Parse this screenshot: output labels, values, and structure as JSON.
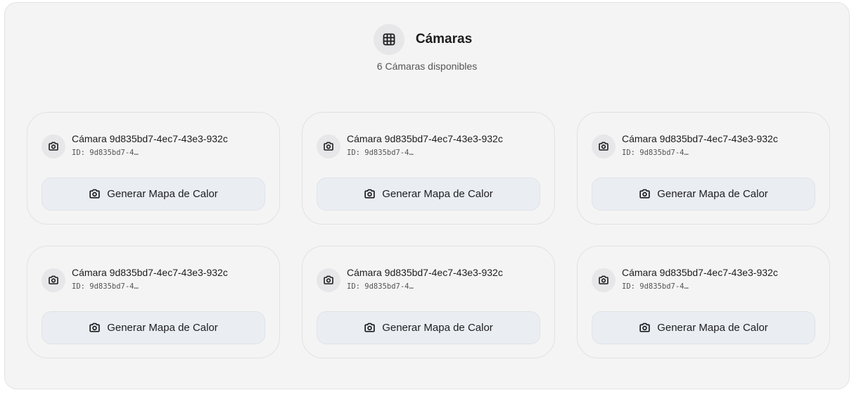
{
  "header": {
    "icon": "grid-icon",
    "title": "Cámaras",
    "subtitle": "6 Cámaras disponibles"
  },
  "cameras": [
    {
      "name": "Cámara 9d835bd7-4ec7-43e3-932c",
      "id": "ID: 9d835bd7-4…",
      "button_label": "Generar Mapa de Calor",
      "icon": "camera-icon"
    },
    {
      "name": "Cámara 9d835bd7-4ec7-43e3-932c",
      "id": "ID: 9d835bd7-4…",
      "button_label": "Generar Mapa de Calor",
      "icon": "camera-icon"
    },
    {
      "name": "Cámara 9d835bd7-4ec7-43e3-932c",
      "id": "ID: 9d835bd7-4…",
      "button_label": "Generar Mapa de Calor",
      "icon": "camera-icon"
    },
    {
      "name": "Cámara 9d835bd7-4ec7-43e3-932c",
      "id": "ID: 9d835bd7-4…",
      "button_label": "Generar Mapa de Calor",
      "icon": "camera-icon"
    },
    {
      "name": "Cámara 9d835bd7-4ec7-43e3-932c",
      "id": "ID: 9d835bd7-4…",
      "button_label": "Generar Mapa de Calor",
      "icon": "camera-icon"
    },
    {
      "name": "Cámara 9d835bd7-4ec7-43e3-932c",
      "id": "ID: 9d835bd7-4…",
      "button_label": "Generar Mapa de Calor",
      "icon": "camera-icon"
    }
  ],
  "colors": {
    "panel_bg": "#f4f4f4",
    "button_bg": "#eaeef3",
    "text": "#1d1d1f"
  }
}
